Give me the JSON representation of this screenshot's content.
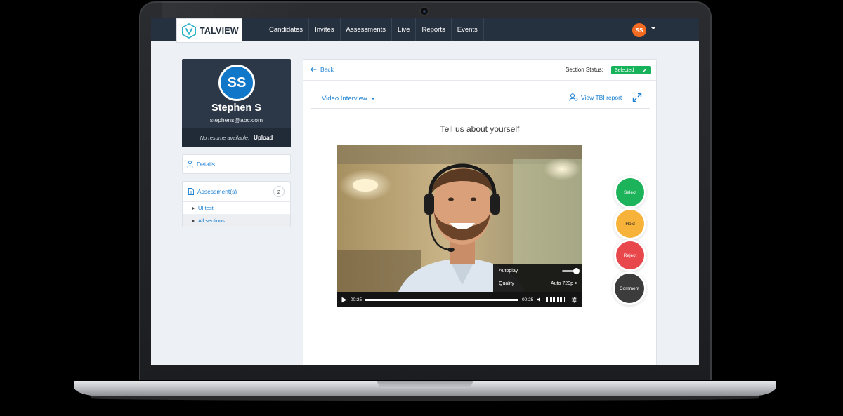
{
  "app": {
    "logo_text": "TALVIEW"
  },
  "nav": {
    "items": [
      {
        "label": "Candidates"
      },
      {
        "label": "Invites"
      },
      {
        "label": "Assessments"
      },
      {
        "label": "Live"
      },
      {
        "label": "Reports"
      },
      {
        "label": "Events"
      }
    ],
    "user_initials": "SS"
  },
  "profile": {
    "initials": "SS",
    "name": "Stephen S",
    "email": "stephens@abc.com",
    "resume_text": "No resume available.",
    "upload_label": "Upload"
  },
  "sidebar": {
    "details_label": "Details",
    "assessments_label": "Assessment(s)",
    "assessments_count": "2",
    "sub_items": [
      {
        "label": "UI test"
      },
      {
        "label": "All sections"
      }
    ]
  },
  "panel": {
    "back_label": "Back",
    "section_status_label": "Section Status:",
    "section_status_value": "Selected",
    "tab_label": "Video Interview",
    "tbi_label": "View TBI report",
    "question": "Tell us about yourself"
  },
  "player": {
    "current_time": "00:25",
    "end_time": "00:25",
    "progress_fraction": 1.0,
    "autoplay_label": "Autoplay",
    "autoplay_on": true,
    "quality_label": "Quality",
    "quality_value": "Auto 720p >"
  },
  "actions": {
    "select_label": "Select",
    "hold_label": "Hold",
    "reject_label": "Reject",
    "comment_label": "Comment"
  },
  "colors": {
    "nav_bg": "#263140",
    "accent_blue": "#1a7fd1",
    "select_green": "#1db35a",
    "hold_orange": "#f7b339",
    "reject_red": "#e8474c",
    "comment_dark": "#3c3c3c",
    "avatar_orange": "#f36b21"
  }
}
